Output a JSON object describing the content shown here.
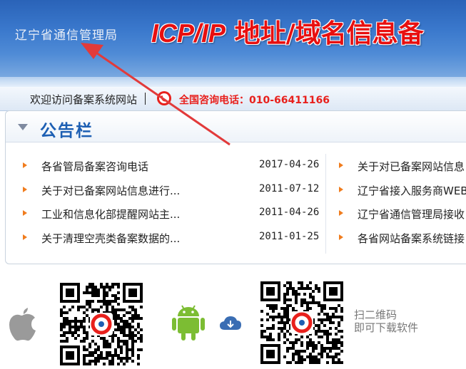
{
  "header": {
    "bureau": "辽宁省通信管理局",
    "title_latin": "ICP/IP",
    "title_cn": " 地址/域名信息备"
  },
  "navbar": {
    "welcome": "欢迎访问备案系统网站",
    "hotline": "全国咨询电话：010-66411166"
  },
  "notice": {
    "title": "公告栏",
    "left_items": [
      {
        "text": "各省管局备案咨询电话",
        "date": "2017-04-26"
      },
      {
        "text": "关于对已备案网站信息进行...",
        "date": "2011-07-12"
      },
      {
        "text": "工业和信息化部提醒网站主...",
        "date": "2011-04-26"
      },
      {
        "text": "关于清理空壳类备案数据的...",
        "date": "2011-01-25"
      }
    ],
    "right_items": [
      {
        "text": "关于对已备案网站信息"
      },
      {
        "text": "辽宁省接入服务商WEB功"
      },
      {
        "text": "辽宁省通信管理局接收"
      },
      {
        "text": "各省网站备案系统链接"
      }
    ]
  },
  "download": {
    "scan_line1": "扫二维码",
    "scan_line2": "即可下载软件",
    "icons": [
      "apple-icon",
      "qr-code-ios",
      "android-icon",
      "cloud-download-icon",
      "qr-code-android"
    ]
  },
  "colors": {
    "accent_blue": "#1d5fb3",
    "title_red": "#e80f0f",
    "hotline_red": "#e8201c",
    "bullet_orange": "#f07c1d",
    "arrow_red": "#e23a3a"
  }
}
